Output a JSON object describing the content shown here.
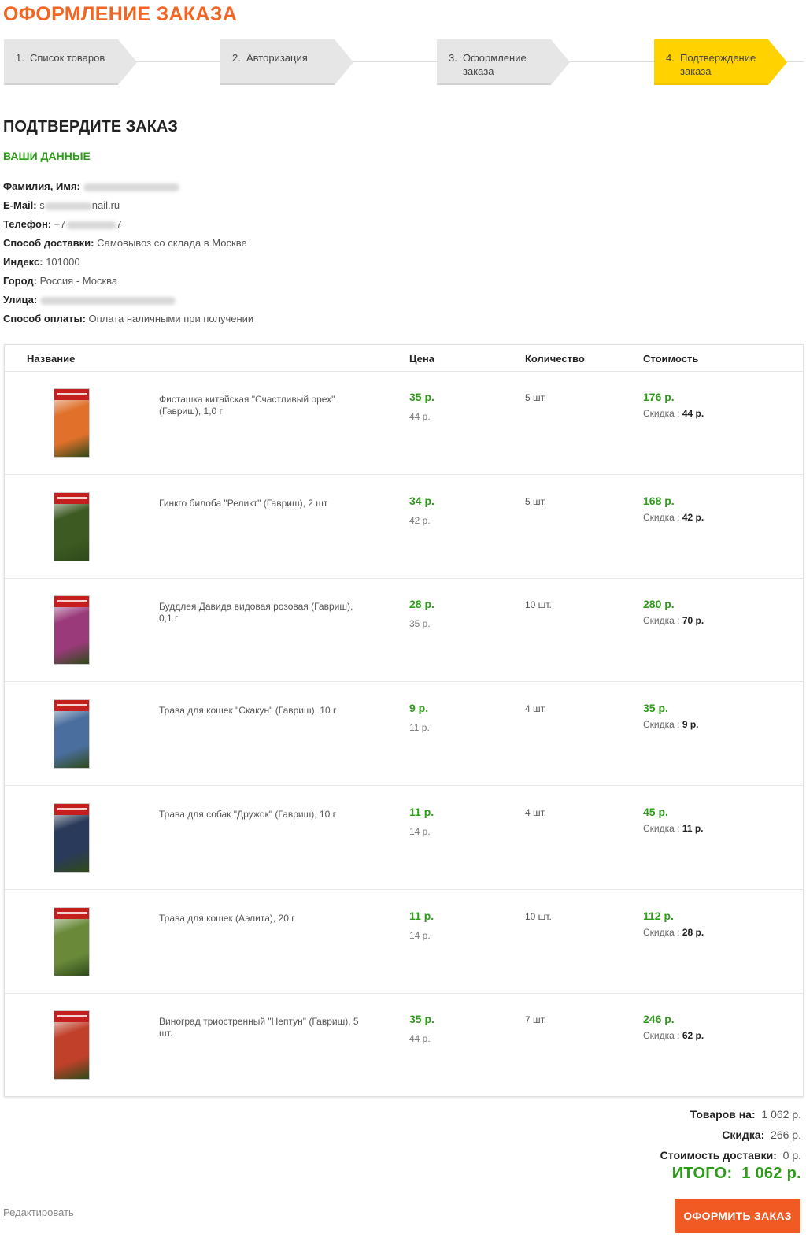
{
  "title": "ОФОРМЛЕНИЕ ЗАКАЗА",
  "steps": [
    {
      "num": "1.",
      "label": "Список товаров",
      "active": false
    },
    {
      "num": "2.",
      "label": "Авторизация",
      "active": false
    },
    {
      "num": "3.",
      "label": "Оформление заказа",
      "active": false
    },
    {
      "num": "4.",
      "label": "Подтверждение заказа",
      "active": true
    }
  ],
  "confirm_title": "ПОДТВЕРДИТЕ ЗАКАЗ",
  "your_data_title": "ВАШИ ДАННЫЕ",
  "customer": {
    "name_label": "Фамилия, Имя:",
    "email_label": "E-Mail:",
    "email_prefix": "s",
    "email_suffix": "nail.ru",
    "phone_label": "Телефон:",
    "phone_prefix": "+7",
    "phone_suffix": "7",
    "delivery_label": "Способ доставки:",
    "delivery_value": "Самовывоз со склада в Москве",
    "index_label": "Индекс:",
    "index_value": "101000",
    "city_label": "Город:",
    "city_value": "Россия - Москва",
    "street_label": "Улица:",
    "payment_label": "Способ оплаты:",
    "payment_value": "Оплата наличными при получении"
  },
  "table": {
    "headers": {
      "name": "Название",
      "price": "Цена",
      "qty": "Количество",
      "cost": "Стоимость"
    },
    "discount_label": "Скидка",
    "rows": [
      {
        "name": "Фисташка китайская \"Счастливый орех\" (Гавриш), 1,0 г",
        "price": "35 р.",
        "old_price": "44 р.",
        "qty": "5 шт.",
        "cost": "176 р.",
        "discount": "44 р.",
        "color": "#e0702a"
      },
      {
        "name": "Гинкго билоба \"Реликт\" (Гавриш), 2 шт",
        "price": "34 р.",
        "old_price": "42 р.",
        "qty": "5 шт.",
        "cost": "168 р.",
        "discount": "42 р.",
        "color": "#3d5a22"
      },
      {
        "name": "Буддлея Давида видовая розовая (Гавриш), 0,1 г",
        "price": "28 р.",
        "old_price": "35 р.",
        "qty": "10 шт.",
        "cost": "280 р.",
        "discount": "70 р.",
        "color": "#9a3a7a"
      },
      {
        "name": "Трава для кошек \"Скакун\" (Гавриш), 10 г",
        "price": "9 р.",
        "old_price": "11 р.",
        "qty": "4 шт.",
        "cost": "35 р.",
        "discount": "9 р.",
        "color": "#4a6e9e"
      },
      {
        "name": "Трава для собак \"Дружок\" (Гавриш), 10 г",
        "price": "11 р.",
        "old_price": "14 р.",
        "qty": "4 шт.",
        "cost": "45 р.",
        "discount": "11 р.",
        "color": "#2a3a5a"
      },
      {
        "name": "Трава для кошек (Аэлита), 20 г",
        "price": "11 р.",
        "old_price": "14 р.",
        "qty": "10 шт.",
        "cost": "112 р.",
        "discount": "28 р.",
        "color": "#6a8a3a"
      },
      {
        "name": "Виноград триостренный \"Нептун\" (Гавриш), 5 шт.",
        "price": "35 р.",
        "old_price": "44 р.",
        "qty": "7 шт.",
        "cost": "246 р.",
        "discount": "62 р.",
        "color": "#c0402a"
      }
    ]
  },
  "totals": {
    "goods_label": "Товаров на:",
    "goods_value": "1 062 р.",
    "discount_label": "Скидка:",
    "discount_value": "266 р.",
    "delivery_label": "Стоимость доставки:",
    "delivery_value": "0 р.",
    "grand_label": "ИТОГО:",
    "grand_value": "1 062 р."
  },
  "edit_label": "Редактировать",
  "submit_label": "ОФОРМИТЬ ЗАКАЗ"
}
